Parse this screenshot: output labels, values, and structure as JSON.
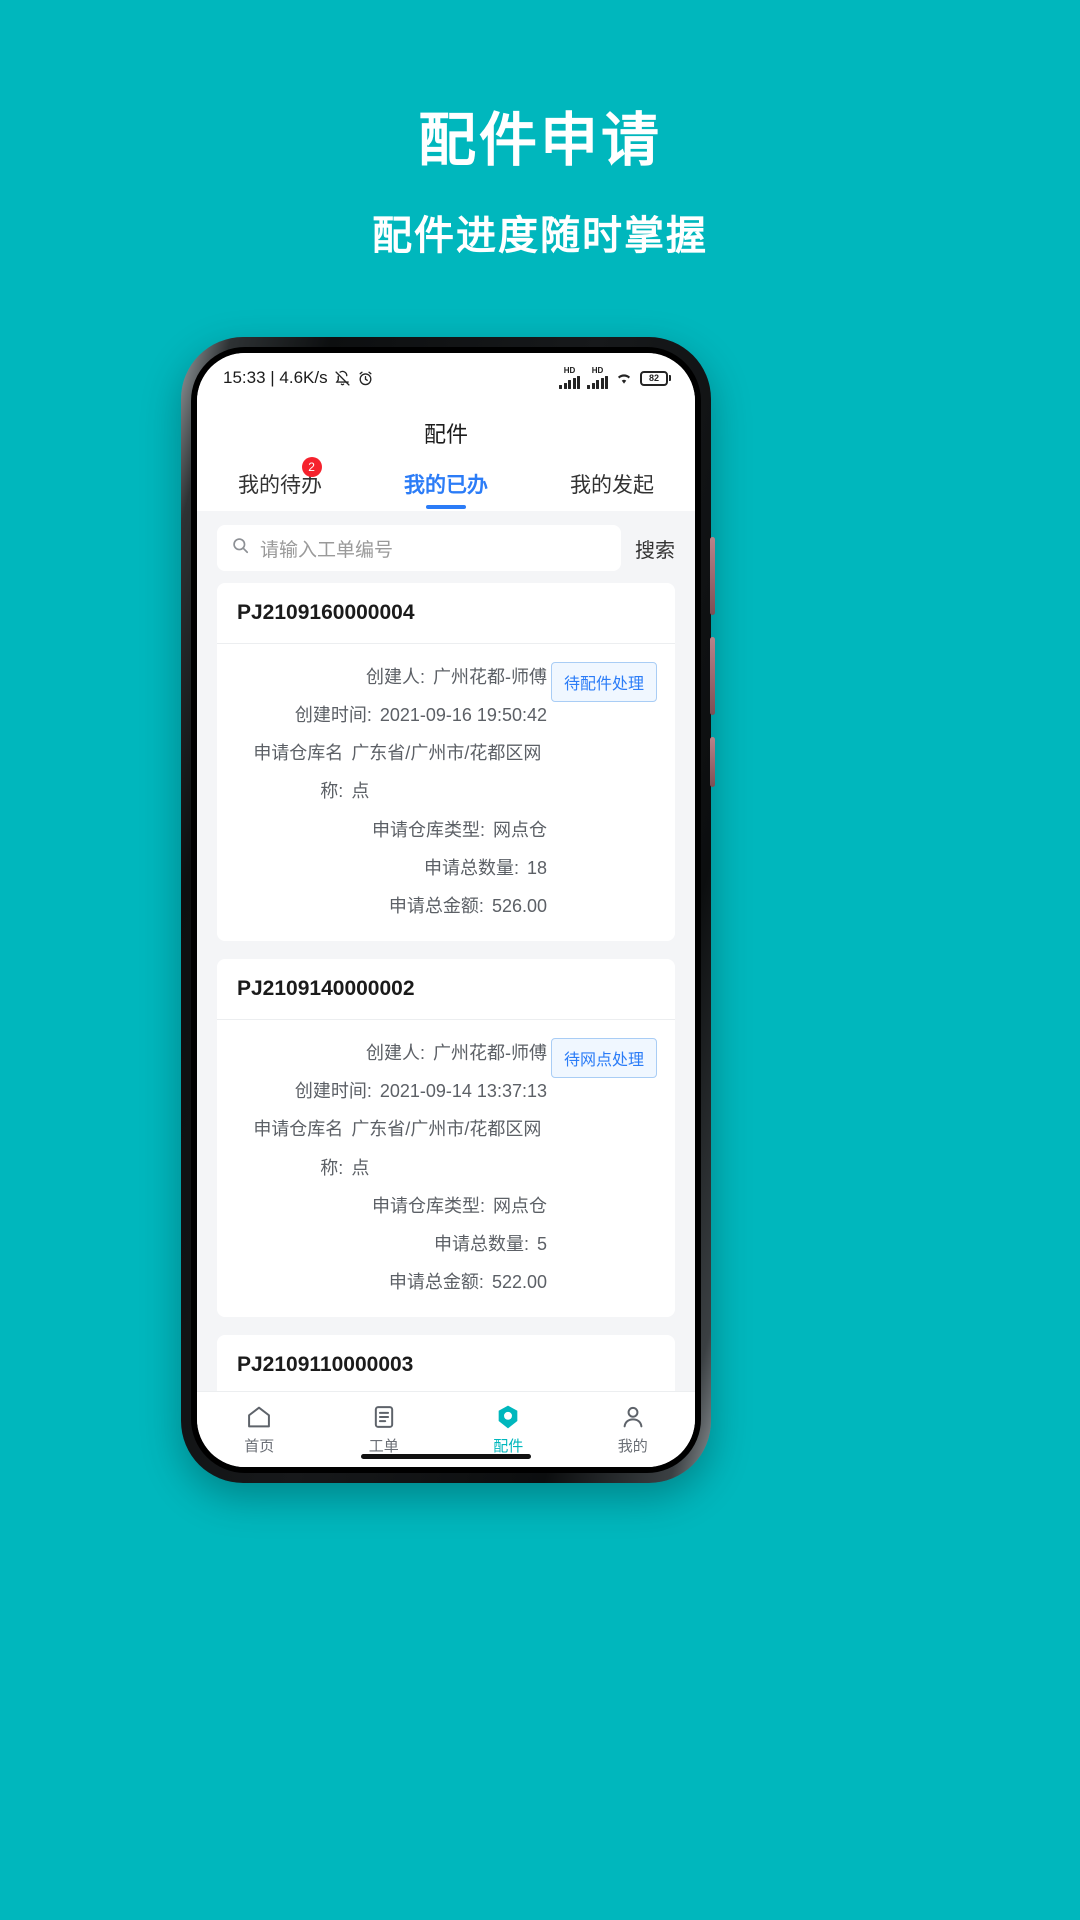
{
  "promo": {
    "title": "配件申请",
    "subtitle": "配件进度随时掌握",
    "brand_color": "#00b7bd"
  },
  "status_bar": {
    "time_and_speed": "15:33 | 4.6K/s",
    "mute_icon": "bell-muted-icon",
    "alarm_icon": "alarm-clock-icon",
    "signal_label_1": "HD",
    "signal_label_2": "HD",
    "wifi_icon": "wifi-icon",
    "battery_level": "82"
  },
  "app": {
    "header_title": "配件",
    "accent_color": "#2b7cf7",
    "tabs": [
      {
        "label": "我的待办",
        "active": false,
        "badge": "2"
      },
      {
        "label": "我的已办",
        "active": true,
        "badge": ""
      },
      {
        "label": "我的发起",
        "active": false,
        "badge": ""
      }
    ],
    "search": {
      "icon": "search-icon",
      "placeholder": "请输入工单编号",
      "value": "",
      "button_label": "搜索"
    },
    "field_labels": {
      "creator": "创建人:",
      "create_time": "创建时间:",
      "warehouse_name": "申请仓库名称:",
      "warehouse_type": "申请仓库类型:",
      "total_qty": "申请总数量:",
      "total_amount": "申请总金额:"
    },
    "cards": [
      {
        "order_no": "PJ2109160000004",
        "status": "待配件处理",
        "creator": "广州花都-师傅",
        "create_time": "2021-09-16 19:50:42",
        "warehouse_name": "广东省/广州市/花都区网点",
        "warehouse_type": "网点仓",
        "total_qty": "18",
        "total_amount": "526.00"
      },
      {
        "order_no": "PJ2109140000002",
        "status": "待网点处理",
        "creator": "广州花都-师傅",
        "create_time": "2021-09-14 13:37:13",
        "warehouse_name": "广东省/广州市/花都区网点",
        "warehouse_type": "网点仓",
        "total_qty": "5",
        "total_amount": "522.00"
      },
      {
        "order_no": "PJ2109110000003",
        "status": "",
        "creator": "",
        "create_time": "",
        "warehouse_name": "",
        "warehouse_type": "",
        "total_qty": "",
        "total_amount": ""
      }
    ],
    "bottom_nav": [
      {
        "label": "首页",
        "icon": "home-icon",
        "active": false
      },
      {
        "label": "工单",
        "icon": "document-icon",
        "active": false
      },
      {
        "label": "配件",
        "icon": "parts-hexagon-icon",
        "active": true
      },
      {
        "label": "我的",
        "icon": "person-icon",
        "active": false
      }
    ],
    "active_nav_color": "#00b7bd"
  }
}
